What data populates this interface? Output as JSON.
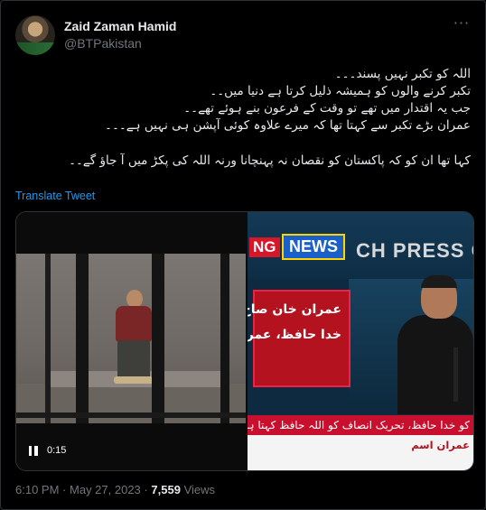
{
  "author": {
    "name": "Zaid Zaman Hamid",
    "handle": "@BTPakistan"
  },
  "more_icon": "more-horizontal-icon",
  "tweet": {
    "lines": [
      "اللہ کو تکبر نہیں پسند۔۔۔",
      "تکبر کرنے والوں کو ہمیشہ ذلیل کرتا ہے دنیا میں۔۔",
      "جب یہ اقتدار میں تھے تو وقت کے فرعون بنے ہوئے تھے۔۔",
      "عمران بڑے تکبر سے کہتا تھا کہ میرے علاوہ کوئی آپشن ہی نہیں ہے۔۔۔",
      "کہا تھا ان کو کہ پاکستان کو نقصان نہ پہنچانا ورنہ اللہ کی پکڑ میں آ جاؤ گے۔۔"
    ],
    "translate_label": "Translate Tweet"
  },
  "media": {
    "video_time": "0:15",
    "pause_icon": "pause-icon",
    "news_badge_left": "NG",
    "news_badge": "NEWS",
    "press_text": "CH PRESS C",
    "red_box_lines": [
      "عمران خان صاح",
      "خدا حافظ، عمران"
    ],
    "ticker_text": "کو خدا حافظ، تحریک انصاف کو اللہ حافظ کہتا ہوں، عمران",
    "bottom_text": "عمران اسم"
  },
  "meta": {
    "time": "6:10 PM",
    "separator": "·",
    "date": "May 27, 2023",
    "views_count": "7,559",
    "views_label": "Views"
  }
}
